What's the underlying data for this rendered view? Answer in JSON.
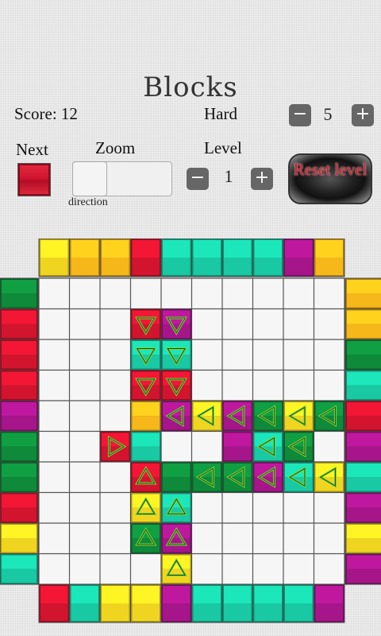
{
  "game": {
    "title": "Blocks",
    "score_label": "Score: 12",
    "difficulty_label": "Hard",
    "difficulty_value": "5",
    "next_label": "Next",
    "zoom_label": "Zoom",
    "level_label": "Level",
    "level_value": "1",
    "direction_label": "direction",
    "reset_label": "Reset level",
    "minus": "−",
    "plus": "+"
  },
  "colors": {
    "R": "#d3142e",
    "G": "#0e8a3a",
    "T": "#18c9a3",
    "Y": "#f0d520",
    "M": "#a6158a",
    "O": "#f6b71a"
  },
  "board": {
    "rows": [
      "..YOOR.TTTMO..",
      "G................",
      "R................",
      "R................",
      "R................",
      "M................",
      "G................",
      "G................",
      "R................",
      "Y................",
      "T................",
      "..RTYYMTTTTR.."
    ],
    "top_edge": [
      "Y",
      "O",
      "O",
      "R",
      "T",
      "T",
      "T",
      "T",
      "M",
      "O"
    ],
    "bottom_edge": [
      "R",
      "T",
      "Y",
      "Y",
      "M",
      "T",
      "T",
      "T",
      "T",
      "M"
    ],
    "left_edge": [
      "G",
      "R",
      "R",
      "R",
      "M",
      "G",
      "G",
      "R",
      "Y",
      "T"
    ],
    "right_edge": [
      "O",
      "O",
      "G",
      "T",
      "R",
      "M",
      "T",
      "M",
      "Y",
      "M"
    ],
    "inner": [
      {
        "c": 3,
        "r": 1,
        "col": "R",
        "arrow": "down"
      },
      {
        "c": 4,
        "r": 1,
        "col": "M",
        "arrow": "down"
      },
      {
        "c": 3,
        "r": 2,
        "col": "T",
        "arrow": "down"
      },
      {
        "c": 4,
        "r": 2,
        "col": "T",
        "arrow": "down"
      },
      {
        "c": 3,
        "r": 3,
        "col": "R",
        "arrow": "down"
      },
      {
        "c": 4,
        "r": 3,
        "col": "R",
        "arrow": "down"
      },
      {
        "c": 3,
        "r": 4,
        "col": "O",
        "arrow": ""
      },
      {
        "c": 4,
        "r": 4,
        "col": "M",
        "arrow": "left"
      },
      {
        "c": 5,
        "r": 4,
        "col": "Y",
        "arrow": "left"
      },
      {
        "c": 6,
        "r": 4,
        "col": "M",
        "arrow": "left"
      },
      {
        "c": 7,
        "r": 4,
        "col": "G",
        "arrow": "left"
      },
      {
        "c": 8,
        "r": 4,
        "col": "Y",
        "arrow": "left"
      },
      {
        "c": 9,
        "r": 4,
        "col": "G",
        "arrow": "left"
      },
      {
        "c": 2,
        "r": 5,
        "col": "R",
        "arrow": "right"
      },
      {
        "c": 3,
        "r": 5,
        "col": "T",
        "arrow": ""
      },
      {
        "c": 6,
        "r": 5,
        "col": "M",
        "arrow": ""
      },
      {
        "c": 7,
        "r": 5,
        "col": "T",
        "arrow": "left"
      },
      {
        "c": 8,
        "r": 5,
        "col": "G",
        "arrow": "left"
      },
      {
        "c": 3,
        "r": 6,
        "col": "R",
        "arrow": "up"
      },
      {
        "c": 4,
        "r": 6,
        "col": "G",
        "arrow": ""
      },
      {
        "c": 5,
        "r": 6,
        "col": "G",
        "arrow": "left"
      },
      {
        "c": 6,
        "r": 6,
        "col": "G",
        "arrow": "left"
      },
      {
        "c": 7,
        "r": 6,
        "col": "M",
        "arrow": "left"
      },
      {
        "c": 8,
        "r": 6,
        "col": "T",
        "arrow": "left"
      },
      {
        "c": 9,
        "r": 6,
        "col": "Y",
        "arrow": "left"
      },
      {
        "c": 3,
        "r": 7,
        "col": "Y",
        "arrow": "up"
      },
      {
        "c": 4,
        "r": 7,
        "col": "T",
        "arrow": "up"
      },
      {
        "c": 3,
        "r": 8,
        "col": "G",
        "arrow": "up"
      },
      {
        "c": 4,
        "r": 8,
        "col": "M",
        "arrow": "up"
      },
      {
        "c": 4,
        "r": 9,
        "col": "Y",
        "arrow": "up"
      }
    ]
  }
}
